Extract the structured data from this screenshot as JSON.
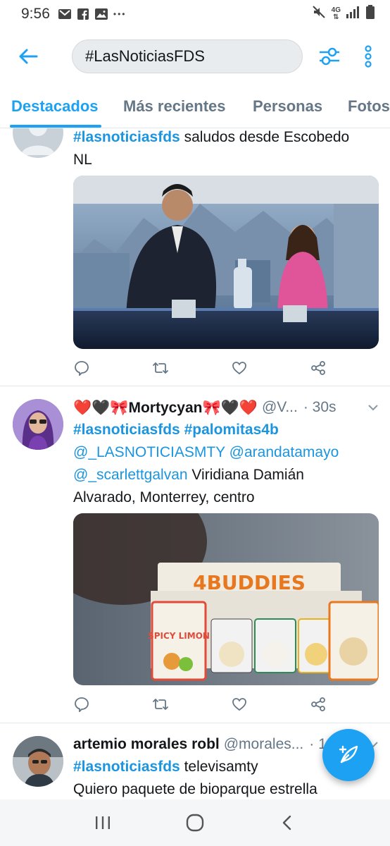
{
  "status_bar": {
    "time": "9:56",
    "ellipsis": "•••",
    "network": "4G"
  },
  "search": {
    "query": "#LasNoticiasFDS"
  },
  "tabs": [
    {
      "label": "Destacados",
      "active": true
    },
    {
      "label": "Más recientes",
      "active": false
    },
    {
      "label": "Personas",
      "active": false
    },
    {
      "label": "Fotos",
      "active": false
    }
  ],
  "tweets": [
    {
      "hashtag": "#lasnoticiasfds",
      "text_line1": " saludos desde Escobedo",
      "text_line2": "NL",
      "media_alt": "news-set-image"
    },
    {
      "name_prefix": "❤️🖤🎀",
      "name": "Mortycyan",
      "name_suffix": "🎀🖤❤️",
      "handle": "@V...",
      "time": "· 30s",
      "hashtag1": "#lasnoticiasfds",
      "hashtag2": "#palomitas4b",
      "mention1": "@_LASNOTICIASMTY",
      "mention2": "@arandatamayo",
      "mention3": "@_scarlettgalvan",
      "text_a": " Viridiana Damián",
      "text_b": "Alvarado, Monterrey, centro",
      "media_brand": "4BUDDIES",
      "media_product": "SPICY LIMON"
    },
    {
      "name": "artemio morales robl",
      "handle": "@morales...",
      "time": "· 1",
      "hashtag": "#lasnoticiasfds",
      "text_line1_tail": "  televisamty",
      "text_line2": "Quiero paquete de bioparque estrella"
    }
  ],
  "colors": {
    "accent": "#1da1f2",
    "link": "#1b95e0",
    "muted": "#657786"
  }
}
